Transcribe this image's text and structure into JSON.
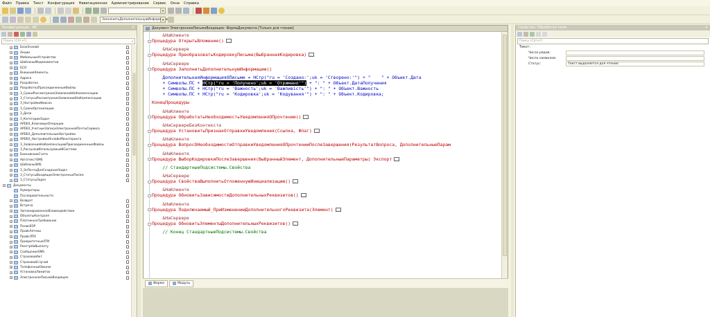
{
  "menu": [
    "Файл",
    "Правка",
    "Текст",
    "Конфигурация",
    "Навигационная",
    "Администрирование",
    "Сервис",
    "Окна",
    "Справка"
  ],
  "toolbar": {
    "search_value": "",
    "combo2_value": "ЗаполнитьДополнительнуюИнформации"
  },
  "left_panel": {
    "title": "Конфигурация - ИС",
    "search_placeholder": "Поиск (Ctrl+F)",
    "items": [
      {
        "label": "БазаЗнаний",
        "level": 1,
        "expand": true
      },
      {
        "label": "Акции",
        "level": 1,
        "expand": true
      },
      {
        "label": "МобильныеУстройства",
        "level": 1,
        "expand": true
      },
      {
        "label": "ШаблоныМедикаментов",
        "level": 1,
        "expand": true
      },
      {
        "label": "БСО",
        "level": 1,
        "expand": true
      },
      {
        "label": "ВнешниеКлиенты",
        "level": 1,
        "expand": true
      },
      {
        "label": "Адреса",
        "level": 1,
        "expand": true
      },
      {
        "label": "Разработка",
        "level": 1,
        "expand": true
      },
      {
        "label": "РазработкаПрисоединенныеФайлы",
        "level": 1,
        "expand": true
      },
      {
        "label": "З_СрокиРассмотренияЗаявленийНаКомпенсацию",
        "level": 1,
        "expand": true
      },
      {
        "label": "З_СтатусыРассмотренияЗаявленийНаКомпенсацию",
        "level": 1,
        "expand": true
      },
      {
        "label": "З_НастройкиФиаско",
        "level": 1,
        "expand": true
      },
      {
        "label": "З_СрокиОрганизации",
        "level": 1,
        "expand": true
      },
      {
        "label": "З_Дела",
        "level": 1,
        "expand": true
      },
      {
        "label": "З_КатегорииЗадач",
        "level": 1,
        "expand": true
      },
      {
        "label": "APDEX_КлючевыеОперации",
        "level": 1,
        "expand": true
      },
      {
        "label": "APDEX_УчетныеЗаписиЭлектроннойПочтыСервиса",
        "level": 1,
        "expand": true
      },
      {
        "label": "APDEX_ДополнительныеНастройки",
        "level": 1,
        "expand": true
      },
      {
        "label": "APDEX_НастройкиОнлайнМониторинга",
        "level": 1,
        "expand": true
      },
      {
        "label": "З_ЗаявленияНаКомпенсациюПрисоединенныеФайлы",
        "level": 1,
        "expand": true
      },
      {
        "label": "З_РассылкиИспользуемыеВСистеме",
        "level": 1,
        "expand": true
      },
      {
        "label": "БанковскиеСчета",
        "level": 1,
        "expand": true
      },
      {
        "label": "АвтотекстSMS",
        "level": 1,
        "expand": true
      },
      {
        "label": "ШаблоныSMS",
        "level": 1,
        "expand": true
      },
      {
        "label": "З_ЭлПочтаДляСозданияЗадач",
        "level": 1,
        "expand": true
      },
      {
        "label": "З_СтатусыВходящихЭлектронныхПисем",
        "level": 1,
        "expand": true
      },
      {
        "label": "З_СтатусыЗадач",
        "level": 1,
        "expand": true
      },
      {
        "label": "Документы",
        "level": 0,
        "expand": true
      },
      {
        "label": "Нумераторы",
        "level": 1,
        "expand": false
      },
      {
        "label": "Последовательности",
        "level": 1,
        "expand": false
      },
      {
        "label": "Возврат",
        "level": 1,
        "expand": true
      },
      {
        "label": "Встреча",
        "level": 1,
        "expand": true
      },
      {
        "label": "ЗапланированноеВзаимодействие",
        "level": 1,
        "expand": true
      },
      {
        "label": "ОбъектыКонтроля",
        "level": 1,
        "expand": true
      },
      {
        "label": "ПлатежноеТребование",
        "level": 1,
        "expand": true
      },
      {
        "label": "ПолисВЗР",
        "level": 1,
        "expand": true
      },
      {
        "label": "ПрайсАптеки",
        "level": 1,
        "expand": true
      },
      {
        "label": "ПрайсЛПУ",
        "level": 1,
        "expand": true
      },
      {
        "label": "ПриоритетныеЛПУ",
        "level": 1,
        "expand": true
      },
      {
        "label": "РеестрНаВыплату",
        "level": 1,
        "expand": true
      },
      {
        "label": "СообщениеSMS",
        "level": 1,
        "expand": true
      },
      {
        "label": "СтраховойАкт",
        "level": 1,
        "expand": true
      },
      {
        "label": "СтраховойСлучай",
        "level": 1,
        "expand": true
      },
      {
        "label": "ТелефонныйЗвонок",
        "level": 1,
        "expand": true
      },
      {
        "label": "УстановкаЛимитов",
        "level": 1,
        "expand": true
      },
      {
        "label": "ЭлектронноеПисьмоВходящее",
        "level": 1,
        "expand": true
      }
    ]
  },
  "code_window": {
    "title": "Документ ЭлектронноеПисьмоВходящее: ФормаДокумента [Только для чтения]",
    "tabs": [
      "Форма",
      "Модуль"
    ],
    "lines": [
      {
        "t": "    &НаКлиенте",
        "c": "dir",
        "dash": false
      },
      {
        "t": "Процедура ОткрытьВложение()",
        "c": "k",
        "dash": true,
        "el": true
      },
      {
        "t": "",
        "c": "s"
      },
      {
        "t": "    &НаСервере",
        "c": "dir",
        "dash": false
      },
      {
        "t": "Процедура ПреобразоватьКодировкуПисьма(ВыбраннаяКодировка)",
        "c": "k",
        "dash": true,
        "el": true
      },
      {
        "t": "",
        "c": "s"
      },
      {
        "t": "    &НаСервере",
        "c": "dir",
        "dash": false
      },
      {
        "t": "Процедура ЗаполнитьДополнительнуюИнформацию()",
        "c": "k",
        "dash": true
      },
      {
        "t": "",
        "c": "s"
      },
      {
        "t": "    ДополнительнаяИнформацияОПисьме = НСтр(\"ru = 'Создано:';uk = 'Створено:'\") + \"    \" + Объект.Дата",
        "c": "id"
      },
      {
        "t": "    + Символы.ПС + ",
        "c": "id",
        "hl": "НСтр(\"ru = 'Получено';uk = 'Отримано'\")",
        "rest": " + \": \" + Объект.ДатаПолучения"
      },
      {
        "t": "    + Символы.ПС + НСтр(\"ru = 'Важность';uk = 'Важливість'\") + \": \" + Объект.Важность",
        "c": "id"
      },
      {
        "t": "    + Символы.ПС + НСтр(\"ru = 'Кодировка';uk = 'Кодування'\") + \": \" + Объект.Кодировка;",
        "c": "id"
      },
      {
        "t": "",
        "c": "s"
      },
      {
        "t": "КонецПроцедуры",
        "c": "k"
      },
      {
        "t": "",
        "c": "s"
      },
      {
        "t": "    &НаКлиенте",
        "c": "dir",
        "dash": false
      },
      {
        "t": "Процедура ОбработатьНеобходимостьУведомленияОПрочтении()",
        "c": "k",
        "dash": true,
        "el": true
      },
      {
        "t": "",
        "c": "s"
      },
      {
        "t": "    &НаСервереБезКонтекста",
        "c": "dir",
        "dash": false
      },
      {
        "t": "Процедура УстановитьПризнакОтправкиУведомления(Ссылка, Флаг)",
        "c": "k",
        "dash": true,
        "el": true
      },
      {
        "t": "",
        "c": "s"
      },
      {
        "t": "    &НаКлиенте",
        "c": "dir",
        "dash": false
      },
      {
        "t": "Процедура ВопросОНеобходимостиОтправкиУведомленияОПрочтенииПослеЗавершения(РезультатВопроса, ДополнительныеПарам",
        "c": "k",
        "dash": true
      },
      {
        "t": "",
        "c": "s"
      },
      {
        "t": "    &НаКлиенте",
        "c": "dir",
        "dash": false
      },
      {
        "t": "Процедура ВыборКодировкиПослеЗавершения(ВыбранныйЭлемент, ДополнительныеПараметры) Экспорт",
        "c": "k",
        "dash": true,
        "el": true
      },
      {
        "t": "",
        "c": "s"
      },
      {
        "t": "    // СтандартныеПодсистемы.Свойства",
        "c": "cm"
      },
      {
        "t": "",
        "c": "s"
      },
      {
        "t": "    &НаСервере",
        "c": "dir",
        "dash": false
      },
      {
        "t": "Процедура СвойстваВыполнитьОтложеннуюИнициализацию()",
        "c": "k",
        "dash": true,
        "el": true
      },
      {
        "t": "",
        "c": "s"
      },
      {
        "t": "    &НаКлиенте",
        "c": "dir",
        "dash": false
      },
      {
        "t": "Процедура ОбновитьЗависимостиДополнительныхРеквизитов()",
        "c": "k",
        "dash": true,
        "el": true
      },
      {
        "t": "",
        "c": "s"
      },
      {
        "t": "    &НаКлиенте",
        "c": "dir",
        "dash": false
      },
      {
        "t": "Процедура Подключаемый_ПриИзмененииДополнительногоРеквизита(Элемент)",
        "c": "k",
        "dash": true,
        "el": true
      },
      {
        "t": "",
        "c": "s"
      },
      {
        "t": "    &НаСервере",
        "c": "dir",
        "dash": false
      },
      {
        "t": "Процедура ОбновитьЭлементыДополнительныхРеквизитов()",
        "c": "k",
        "dash": true,
        "el": true
      },
      {
        "t": "",
        "c": "s"
      },
      {
        "t": "    // Конец СтандартныеПодсистемы.Свойства",
        "c": "cm"
      }
    ]
  },
  "right_panel": {
    "title": "Свойства: Обработка поля",
    "search_placeholder": "Поиск (Ctrl+F)",
    "group": "Текст:",
    "props": [
      {
        "label": "Число рядов:",
        "value": ""
      },
      {
        "label": "Число символов:",
        "value": ""
      },
      {
        "label": "Статус:",
        "value": "Текст выделяется для чтения"
      }
    ]
  },
  "colors": {
    "keyword": "#c00000",
    "identifier": "#0000c8",
    "comment": "#007000",
    "background": "#f4f3e1"
  }
}
